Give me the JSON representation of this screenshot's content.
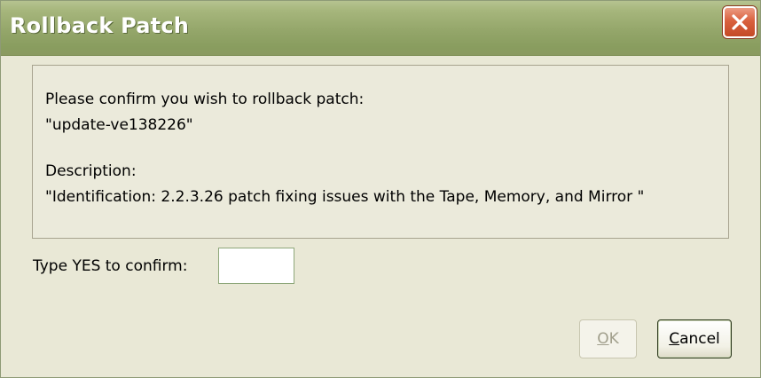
{
  "window": {
    "title": "Rollback Patch"
  },
  "message": {
    "line1": "Please confirm you wish to rollback patch:",
    "patch_name": "\"update-ve138226\"",
    "description_label": "Description:",
    "description_text": "\"Identification: 2.2.3.26 patch fixing issues with the Tape, Memory, and Mirror \""
  },
  "confirm": {
    "label": "Type YES to confirm:",
    "value": ""
  },
  "buttons": {
    "ok_mnemonic": "O",
    "ok_rest": "K",
    "ok_enabled": false,
    "cancel_mnemonic": "C",
    "cancel_rest": "ancel"
  },
  "icons": {
    "close": "close-icon"
  },
  "colors": {
    "titlebar": "#94a66a",
    "close_button": "#d9613e",
    "dialog_bg": "#e9e8d6"
  }
}
